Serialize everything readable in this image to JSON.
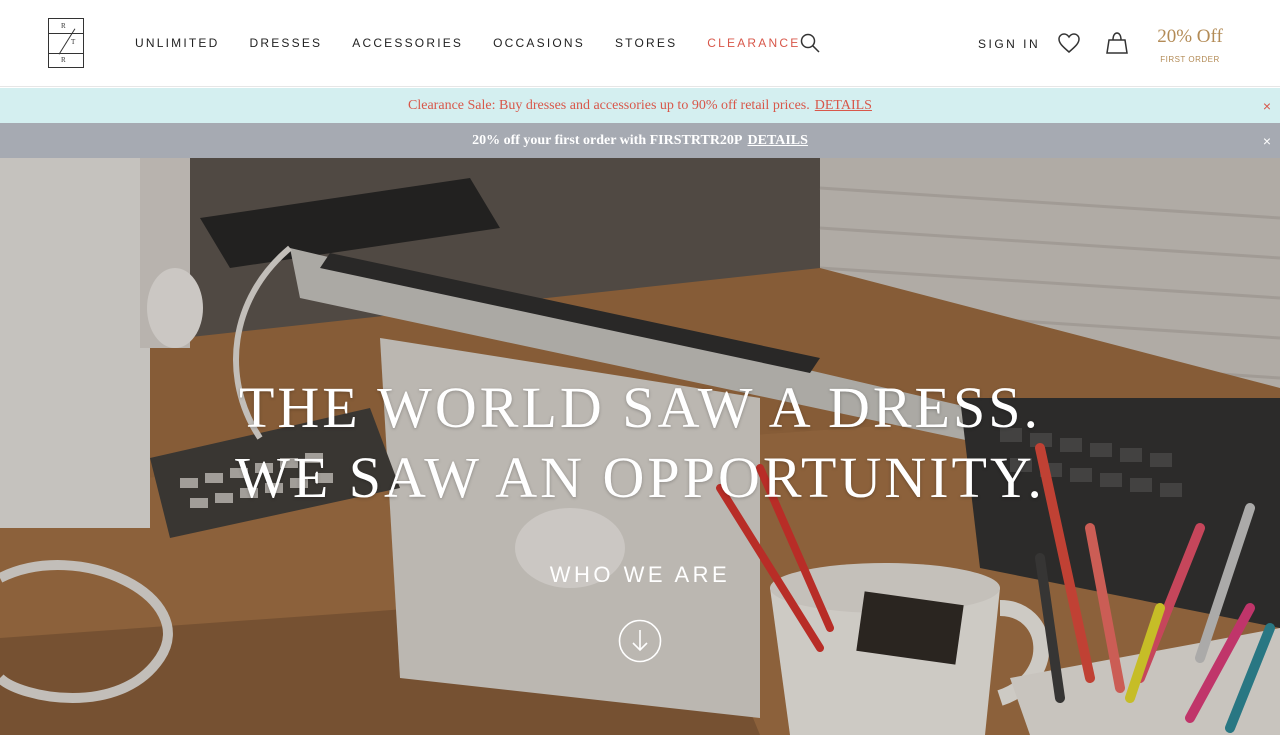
{
  "header": {
    "logo_letters": [
      "R",
      "T",
      "R"
    ],
    "nav": [
      "UNLIMITED",
      "DRESSES",
      "ACCESSORIES",
      "OCCASIONS",
      "STORES",
      "CLEARANCE"
    ],
    "sign_in": "SIGN IN",
    "promo_big": "20% Off",
    "promo_small": "FIRST ORDER"
  },
  "banners": {
    "clearance_text": "Clearance Sale: Buy dresses and accessories up to 90% off retail prices.",
    "clearance_link": "DETAILS",
    "promo_text": "20% off your first order with FIRSTRTR20P",
    "promo_link": "DETAILS",
    "close_glyph": "×"
  },
  "hero": {
    "headline_line1": "THE WORLD SAW A DRESS.",
    "headline_line2": "WE SAW AN OPPORTUNITY.",
    "cta": "WHO WE ARE"
  },
  "colors": {
    "accent_red": "#d8574a",
    "gold": "#b38b56",
    "banner_teal": "#d4eff0",
    "banner_gray": "#a6aab2"
  },
  "icons": [
    "logo-icon",
    "search-icon",
    "heart-icon",
    "bag-icon",
    "close-icon",
    "arrow-down-icon"
  ]
}
